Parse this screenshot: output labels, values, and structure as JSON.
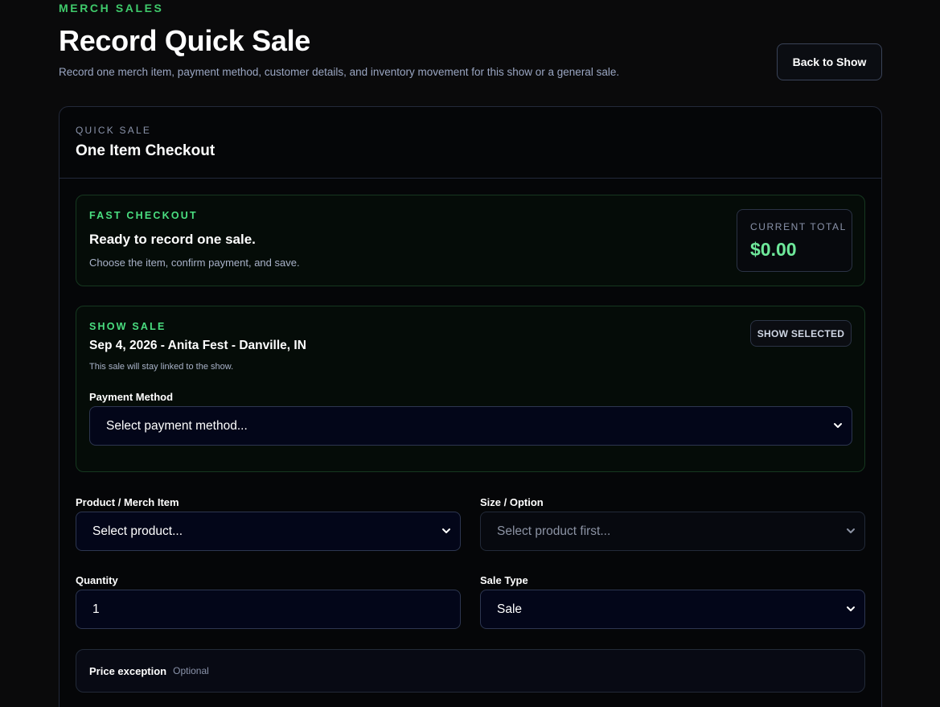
{
  "header": {
    "eyebrow": "MERCH SALES",
    "title": "Record Quick Sale",
    "subtitle": "Record one merch item, payment method, customer details, and inventory movement for this show or a general sale.",
    "back_label": "Back to Show"
  },
  "card": {
    "eyebrow": "QUICK SALE",
    "title": "One Item Checkout"
  },
  "fast_checkout": {
    "eyebrow": "FAST CHECKOUT",
    "title": "Ready to record one sale.",
    "description": "Choose the item, confirm payment, and save.",
    "total_label": "CURRENT TOTAL",
    "total_value": "$0.00"
  },
  "show_sale": {
    "eyebrow": "SHOW SALE",
    "title": "Sep 4, 2026 - Anita Fest - Danville, IN",
    "note": "This sale will stay linked to the show.",
    "badge": "SHOW SELECTED",
    "payment_label": "Payment Method",
    "payment_value": "Select payment method..."
  },
  "form": {
    "product_label": "Product / Merch Item",
    "product_value": "Select product...",
    "size_label": "Size / Option",
    "size_value": "Select product first...",
    "quantity_label": "Quantity",
    "quantity_value": "1",
    "sale_type_label": "Sale Type",
    "sale_type_value": "Sale"
  },
  "price_exception": {
    "label": "Price exception",
    "optional": "Optional"
  },
  "colors": {
    "background": "#0a0a0b",
    "accent_green": "#4ade80",
    "total_green": "#6ee89a",
    "input_bg": "#030619"
  },
  "icons": {
    "select_arrow": "chevron-down-icon"
  }
}
